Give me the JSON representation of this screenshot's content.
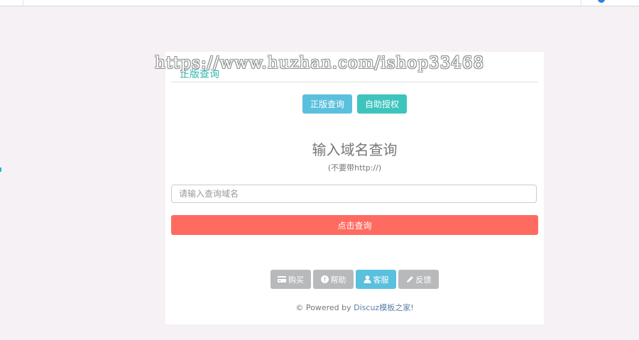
{
  "watermark": "https://www.huzhan.com/ishop33468",
  "panel": {
    "title": "正版查询",
    "tabs": [
      {
        "label": "正版查询",
        "color": "#5bc0de"
      },
      {
        "label": "自助授权",
        "color": "#3dc4bd"
      }
    ],
    "heading": "输入域名查询",
    "subheading": "(不要带http://)",
    "domain_input": {
      "placeholder": "请输入查询域名",
      "value": ""
    },
    "query_button": "点击查询",
    "footer_buttons": [
      {
        "label": "购买",
        "icon": "card-icon"
      },
      {
        "label": "帮助",
        "icon": "info-icon"
      },
      {
        "label": "客服",
        "icon": "user-icon"
      },
      {
        "label": "反馈",
        "icon": "pencil-icon"
      }
    ],
    "powered_prefix": "© Powered by ",
    "powered_link": "Discuz模板之家!"
  },
  "colors": {
    "accent_teal": "#2fb8ab",
    "info_blue": "#5bc0de",
    "danger_coral": "#ff6b61",
    "muted_gray": "#b7b9bb"
  }
}
